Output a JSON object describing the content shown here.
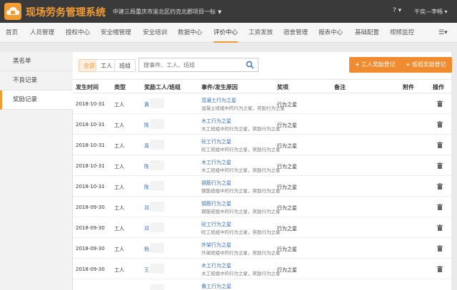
{
  "app": {
    "title": "现场劳务管理系统",
    "project": "中建三局重庆市渝北区约克北郡项目一标",
    "help": "?",
    "user": "干奕—李畅"
  },
  "nav": [
    "首页",
    "人员管理",
    "授权中心",
    "安全帽管理",
    "安全培训",
    "数据中心",
    "评价中心",
    "工资发放",
    "宿舍管理",
    "报表中心",
    "基础配置",
    "视频监控"
  ],
  "nav_active": "评价中心",
  "sidebar": [
    "黑名单",
    "不良记录",
    "奖励记录"
  ],
  "sidebar_active": "奖励记录",
  "filters": [
    "全部",
    "工人",
    "班组"
  ],
  "search": {
    "placeholder": "搜事件、工人、班组"
  },
  "buttons": {
    "worker_award": "工人奖励登记",
    "team_award": "班组奖励登记"
  },
  "table": {
    "headers": [
      "发生时间",
      "类型",
      "奖励工人/班组",
      "事件/发生原因",
      "奖项",
      "备注",
      "附件",
      "操作"
    ],
    "rows": [
      {
        "date": "2018-10-31",
        "type": "工人",
        "name": "黄",
        "event": "混凝土行为之星",
        "reason": "混凝土班组中的行为之星，奖励行为之星",
        "award": "行为之星"
      },
      {
        "date": "2018-10-31",
        "type": "工人",
        "name": "陈",
        "event": "木工行为之星",
        "reason": "木工班组中的行为之星，奖励行为之星",
        "award": "行为之星"
      },
      {
        "date": "2018-10-31",
        "type": "工人",
        "name": "周",
        "event": "砼工行为之星",
        "reason": "砼工班组中的行为之星，奖励行为之星",
        "award": "行为之星"
      },
      {
        "date": "2018-10-31",
        "type": "工人",
        "name": "陈",
        "event": "木工行为之星",
        "reason": "木工班组中的行为之星，奖励行为之星",
        "award": "行为之星"
      },
      {
        "date": "2018-10-31",
        "type": "工人",
        "name": "陈",
        "event": "钢筋行为之星",
        "reason": "钢筋班组中的行为之星，奖励行为之星",
        "award": "行为之星"
      },
      {
        "date": "2018-09-30",
        "type": "工人",
        "name": "邓",
        "event": "钢筋行为之星",
        "reason": "钢筋班组中的行为之星，奖励行为之星",
        "award": "行为之星"
      },
      {
        "date": "2018-09-30",
        "type": "工人",
        "name": "邓",
        "event": "砼工行为之星",
        "reason": "砼工班组中的行为之星，奖励行为之星",
        "award": "行为之星"
      },
      {
        "date": "2018-09-30",
        "type": "工人",
        "name": "杨",
        "event": "外架行为之星",
        "reason": "外架班组中的行为之星，奖励行为之星",
        "award": "行为之星"
      },
      {
        "date": "2018-09-30",
        "type": "工人",
        "name": "王",
        "event": "木工行为之星",
        "reason": "木工班组中的行为之星，奖励行为之星",
        "award": "行为之星"
      },
      {
        "date": "",
        "type": "",
        "name": "",
        "event": "番工行为之星",
        "reason": "",
        "award": ""
      }
    ]
  }
}
